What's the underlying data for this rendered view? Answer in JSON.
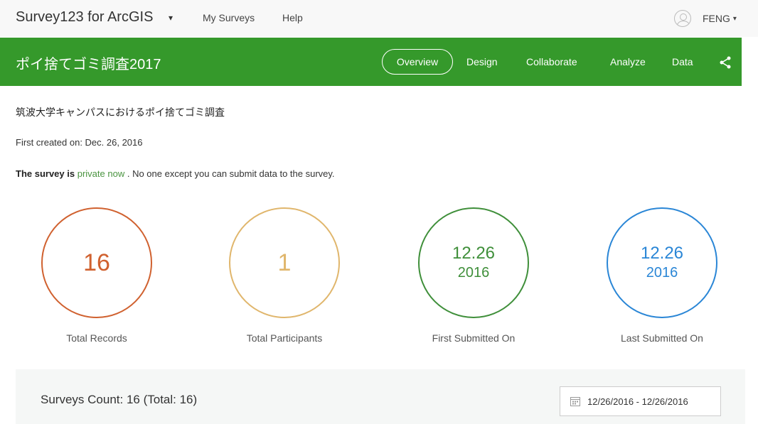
{
  "topbar": {
    "app_title": "Survey123 for ArcGIS",
    "caret": "▾",
    "nav": [
      "My Surveys",
      "Help"
    ],
    "user_name": "FENG",
    "user_caret": "▾"
  },
  "header": {
    "survey_title": "ポイ捨てゴミ調査2017",
    "tabs": [
      "Overview",
      "Design",
      "Collaborate",
      "Analyze",
      "Data"
    ],
    "active_tab": "Overview",
    "share_icon": "share-icon"
  },
  "content": {
    "description": "筑波大学キャンパスにおけるポイ捨てゴミ調査",
    "created": "First created on: Dec. 26, 2016",
    "privacy": {
      "prefix": "The survey is",
      "link": "private now",
      "suffix": ". No one except you can submit data to the survey."
    }
  },
  "stats": [
    {
      "value": "16",
      "label": "Total Records",
      "color": "#d0612f"
    },
    {
      "value": "1",
      "label": "Total Participants",
      "color": "#e0b66c"
    },
    {
      "date": "12.26",
      "year": "2016",
      "label": "First Submitted On",
      "color": "#3f8f3a"
    },
    {
      "date": "12.26",
      "year": "2016",
      "label": "Last Submitted On",
      "color": "#2a86d6"
    }
  ],
  "panel": {
    "count": "Surveys Count: 16 (Total: 16)",
    "date_range": "12/26/2016 - 12/26/2016",
    "calendar_icon": "calendar-icon"
  }
}
